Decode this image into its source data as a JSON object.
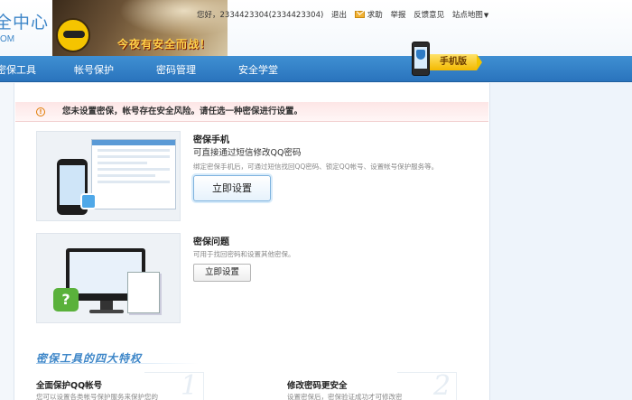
{
  "header": {
    "logo_title": "全中心",
    "logo_sub": "OM",
    "banner_slogan": "今夜有安全而战！",
    "user_greeting": "您好，2334423304(2334423304)",
    "links": {
      "logout": "退出",
      "help": "求助",
      "report": "举报",
      "feedback": "反馈意见",
      "sitemap": "站点地图"
    }
  },
  "nav": {
    "items": [
      "密保工具",
      "帐号保护",
      "密码管理",
      "安全学堂"
    ],
    "mobile_badge": "手机版"
  },
  "warning": {
    "text": "您未设置密保，帐号存在安全风险。请任选一种密保进行设置。"
  },
  "options": [
    {
      "title": "密保手机",
      "subtitle": "可直接通过短信修改QQ密码",
      "desc": "绑定密保手机后，可通过短信找回QQ密码、锁定QQ帐号、设置帐号保护服务等。",
      "button": "立即设置"
    },
    {
      "title": "密保问题",
      "desc": "可用于找回密码和设置其他密保。",
      "button": "立即设置"
    }
  ],
  "features": {
    "title": "密保工具的四大特权",
    "items": [
      {
        "title": "全面保护QQ帐号",
        "desc": "您可以设置各类帐号保护服务来保护您的",
        "num": "1"
      },
      {
        "title": "修改密码更安全",
        "desc": "设置密保后，密保验证成功才可修改密",
        "num": "2"
      }
    ]
  },
  "colors": {
    "nav_blue": "#2f7fc6",
    "accent": "#3d86c8",
    "warning_bg": "#fde6e6"
  }
}
